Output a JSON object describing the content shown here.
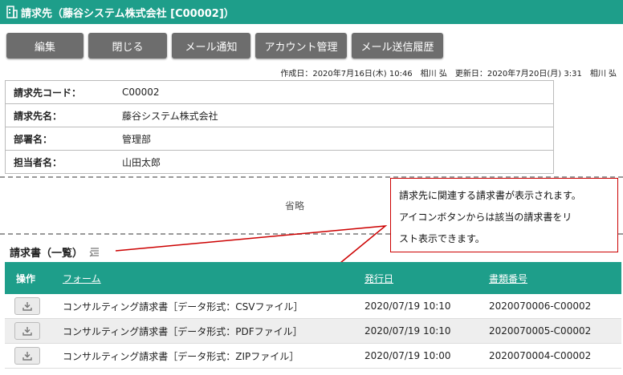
{
  "title": "請求先（藤谷システム株式会社 [C00002]）",
  "buttons": {
    "edit": "編集",
    "close": "閉じる",
    "mail_notify": "メール通知",
    "account": "アカウント管理",
    "mail_history": "メール送信履歴"
  },
  "meta": "作成日：2020年7月16日(木) 10:46　相川 弘　更新日：2020年7月20日(月) 3:31　相川 弘",
  "info": [
    {
      "label": "請求先コード：",
      "value": "C00002"
    },
    {
      "label": "請求先名：",
      "value": "藤谷システム株式会社"
    },
    {
      "label": "部署名：",
      "value": "管理部"
    },
    {
      "label": "担当者名：",
      "value": "山田太郎"
    }
  ],
  "omitted": "省略",
  "callout": {
    "line1": "請求先に関連する請求書が表示されます。",
    "line2": "アイコンボタンからは該当の請求書をリ",
    "line3": "スト表示できます。"
  },
  "section_title": "請求書（一覧）",
  "grid": {
    "headers": {
      "op": "操作",
      "form": "フォーム",
      "date": "発行日",
      "number": "書類番号"
    },
    "rows": [
      {
        "form": "コンサルティング請求書［データ形式：CSVファイル］",
        "date": "2020/07/19 10:10",
        "number": "2020070006-C00002"
      },
      {
        "form": "コンサルティング請求書［データ形式：PDFファイル］",
        "date": "2020/07/19 10:10",
        "number": "2020070005-C00002"
      },
      {
        "form": "コンサルティング請求書［データ形式：ZIPファイル］",
        "date": "2020/07/19 10:00",
        "number": "2020070004-C00002"
      }
    ]
  },
  "colors": {
    "header": "#1e9e8a",
    "button": "#6d6d6d",
    "callout_border": "#cc0000"
  },
  "icons": {
    "title": "building-icon",
    "list": "list-icon",
    "download": "download-icon"
  }
}
